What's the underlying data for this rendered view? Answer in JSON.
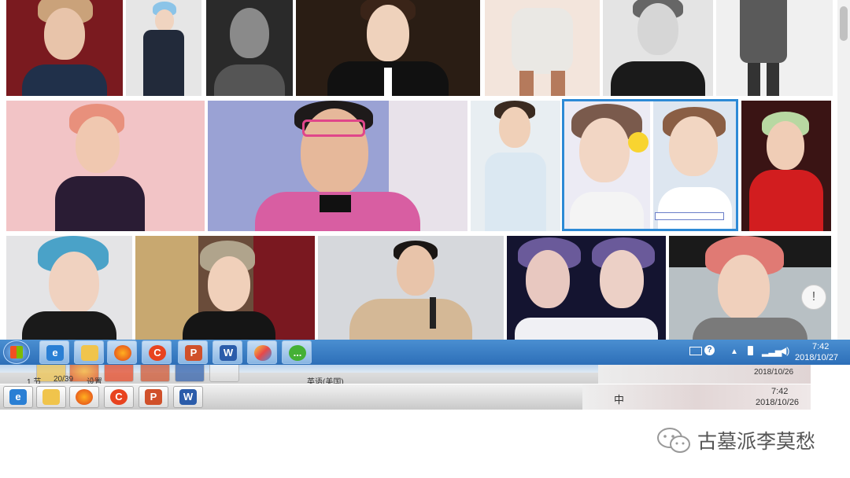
{
  "screen": {
    "search_results": {
      "more_button_glyph": "!"
    },
    "taskbar": {
      "clock_time": "7:42",
      "clock_date": "2018/10/27",
      "help_icon_glyph": "?",
      "apps": [
        {
          "name": "start-orb",
          "glyph": ""
        },
        {
          "name": "internet-explorer",
          "glyph": "e"
        },
        {
          "name": "file-explorer",
          "glyph": ""
        },
        {
          "name": "firefox",
          "glyph": ""
        },
        {
          "name": "360-browser",
          "glyph": "C"
        },
        {
          "name": "powerpoint",
          "glyph": "P"
        },
        {
          "name": "word",
          "glyph": "W"
        },
        {
          "name": "paint",
          "glyph": ""
        },
        {
          "name": "wechat",
          "glyph": "..."
        }
      ]
    },
    "ghost_taskbar_1": {
      "status_left": "1 节",
      "status_page": "20/39",
      "status_mid": "设置",
      "status_language": "英语(美国)",
      "clock_date": "2018/10/26"
    },
    "ghost_taskbar_2": {
      "ime_label": "中",
      "clock_time": "7:42",
      "clock_date": "2018/10/26",
      "app_glyphs": [
        "e",
        "",
        "",
        "C",
        "P",
        "W"
      ]
    },
    "watermark": {
      "text": "古墓派李莫愁"
    },
    "colors": {
      "taskbar_blue": "#2d6fb8",
      "selection_blue": "#2d8ad6"
    }
  }
}
